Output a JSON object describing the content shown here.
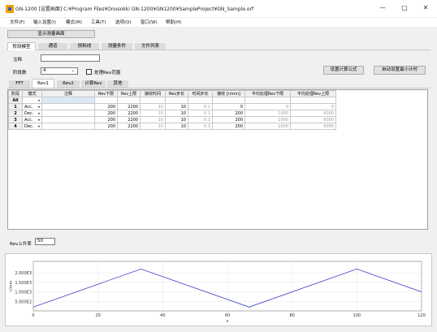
{
  "window": {
    "title": "GN-1200 [设置画面] C:¥Program Files¥Onosokki GN-1200¥GN1200¥SampleProject¥GN_Sample.orf",
    "minimize": "—",
    "maximize": "□",
    "close": "✕"
  },
  "menu": [
    "文件(F)",
    "输入设置(I)",
    "模式(M)",
    "工具(T)",
    "选项(O)",
    "窗口(W)",
    "帮助(H)"
  ],
  "display_button": "显示测量画面",
  "main_tabs": [
    "阶段模型",
    "通道",
    "损耗线",
    "测量条件",
    "文件列表"
  ],
  "note_label": "注释",
  "note_value": "",
  "stage_count_label": "阶段数",
  "stage_count_value": "4",
  "process_rev_label": "处理Rev范围",
  "formula_button": "设置计算公式",
  "auto_time_button": "自动设置最小计时",
  "sub_tabs": [
    "FFT",
    "Rev1",
    "Rev2",
    "计算Rev",
    "其他"
  ],
  "table": {
    "headers": [
      "阶段",
      "模式",
      "注释",
      "Rev下限",
      "Rev上限",
      "接收时间",
      "Rev步长",
      "时间步长",
      "接收 [r/min]",
      "平均处理Rev下限",
      "平均处理Rev上限"
    ],
    "all_row": {
      "stage": "All",
      "mode": "",
      "note": ""
    },
    "rows": [
      {
        "stage": "1",
        "mode": "Acc.",
        "note": "",
        "rev_low": "200",
        "rev_high": "2200",
        "recv_time": "10",
        "rev_step": "10",
        "time_step": "0.1",
        "recv": "0",
        "avg_low": "0",
        "avg_high": "0"
      },
      {
        "stage": "2",
        "mode": "Dec.",
        "note": "",
        "rev_low": "200",
        "rev_high": "2200",
        "recv_time": "10",
        "rev_step": "10",
        "time_step": "0.1",
        "recv": "200",
        "avg_low": "1000",
        "avg_high": "6000"
      },
      {
        "stage": "3",
        "mode": "Acc.",
        "note": "",
        "rev_low": "200",
        "rev_high": "2200",
        "recv_time": "10",
        "rev_step": "10",
        "time_step": "0.1",
        "recv": "200",
        "avg_low": "1000",
        "avg_high": "6000"
      },
      {
        "stage": "4",
        "mode": "Dec.",
        "note": "",
        "rev_low": "200",
        "rev_high": "2200",
        "recv_time": "10",
        "rev_step": "10",
        "time_step": "0.1",
        "recv": "200",
        "avg_low": "1000",
        "avg_high": "6000"
      }
    ]
  },
  "rev_rise_label": "Rev上升率",
  "rev_rise_value": "50",
  "chart_data": {
    "type": "line",
    "title": "",
    "xlabel": "s",
    "ylabel": "r/min",
    "xlim": [
      0,
      120
    ],
    "ylim": [
      0,
      2600
    ],
    "x_ticks": [
      0,
      20,
      40,
      60,
      80,
      100,
      120
    ],
    "y_ticks": [
      500,
      1000,
      1500,
      2000
    ],
    "y_tick_labels": [
      "5.000E2",
      "1.000E3",
      "1.500E3",
      "2.000E3"
    ],
    "grid": true,
    "series": [
      {
        "x": [
          0,
          33.3,
          66.7,
          100,
          133.3
        ],
        "values": [
          200,
          2200,
          200,
          2200,
          200
        ],
        "color": "#3c3cc8"
      }
    ]
  }
}
